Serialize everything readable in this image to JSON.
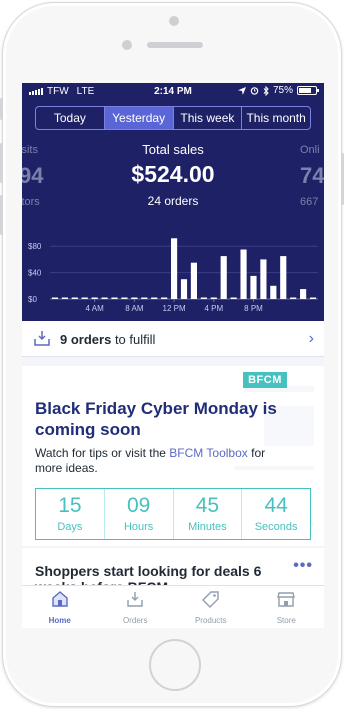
{
  "status_bar": {
    "carrier": "TFW",
    "network": "LTE",
    "time": "2:14 PM",
    "battery": "75%",
    "battery_level": 0.75
  },
  "tabs": [
    {
      "label": "Today",
      "active": false
    },
    {
      "label": "Yesterday",
      "active": true
    },
    {
      "label": "This week",
      "active": false
    },
    {
      "label": "This month",
      "active": false
    }
  ],
  "left_metric": {
    "top": "isits",
    "value": "94",
    "bottom": "itors"
  },
  "right_metric": {
    "top": "Onli",
    "value": "74",
    "bottom": "667"
  },
  "total_sales": {
    "label": "Total sales",
    "value": "$524.00",
    "orders": "24 orders"
  },
  "chart_data": {
    "type": "bar",
    "y_ticks": [
      "$80",
      "$40",
      "$0"
    ],
    "ylim": [
      0,
      100
    ],
    "x_ticks": [
      "4 AM",
      "8 AM",
      "12 PM",
      "4 PM",
      "8 PM"
    ],
    "values": [
      0,
      0,
      0,
      0,
      0,
      0,
      0,
      0,
      0,
      0,
      0,
      0,
      92,
      30,
      55,
      0,
      0,
      65,
      0,
      75,
      35,
      60,
      20,
      65,
      0,
      15,
      0
    ],
    "grid": true,
    "bar_color": "#ffffff"
  },
  "fulfill": {
    "count": "9 orders",
    "suffix": "to fulfill"
  },
  "promo": {
    "tag": "BFCM",
    "title": "Black Friday Cyber Monday is coming soon",
    "body_prefix": "Watch for tips or visit the",
    "link": "BFCM Toolbox",
    "body_suffix": "for more ideas."
  },
  "countdown": [
    {
      "value": "15",
      "label": "Days"
    },
    {
      "value": "09",
      "label": "Hours"
    },
    {
      "value": "45",
      "label": "Minutes"
    },
    {
      "value": "44",
      "label": "Seconds"
    }
  ],
  "next_card": {
    "title": "Shoppers start looking for deals 6",
    "title_cut": "weeks before BFCM",
    "more": "•••"
  },
  "bottom_nav": [
    {
      "label": "Home",
      "icon": "home-icon",
      "active": true
    },
    {
      "label": "Orders",
      "icon": "orders-icon",
      "active": false
    },
    {
      "label": "Products",
      "icon": "tag-icon",
      "active": false
    },
    {
      "label": "Store",
      "icon": "store-icon",
      "active": false
    }
  ],
  "colors": {
    "header": "#1f2166",
    "accent": "#5c6ac4",
    "teal": "#47c1bf",
    "title": "#202e78"
  }
}
